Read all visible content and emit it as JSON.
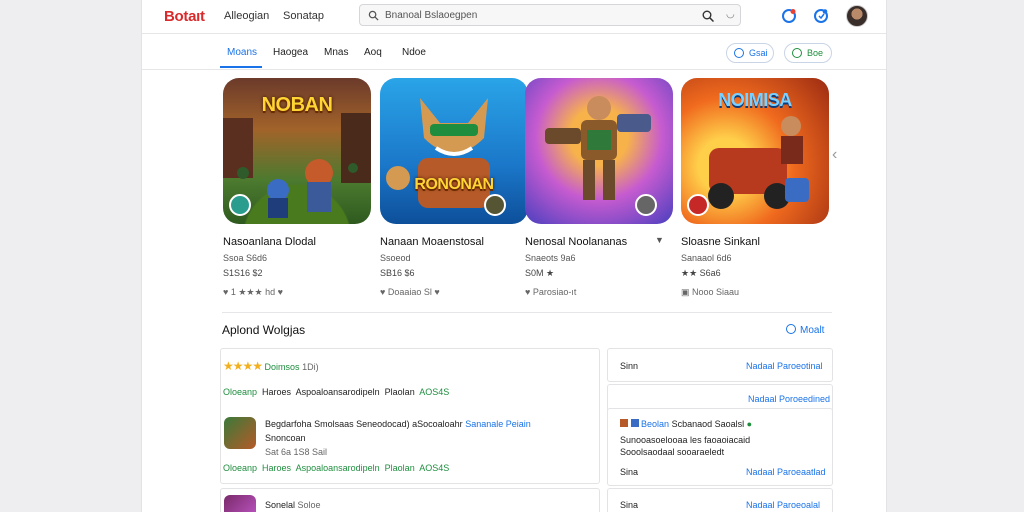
{
  "header": {
    "logo": "Botaıt",
    "nav": [
      "Alleogian",
      "Sonatap"
    ],
    "search_text": "Bnanoal Bslaoegpen",
    "mic": "◡",
    "icons": [
      "search-icon",
      "notification-icon",
      "apps-icon"
    ]
  },
  "tabs": {
    "items": [
      "Moans",
      "Haogea",
      "Mnas",
      "Aoq",
      "Ndoe"
    ],
    "active": 0,
    "pill_1": "Gsai",
    "pill_2": "Boe"
  },
  "cards": [
    {
      "art_title": "NOBAN",
      "title": "Nasoanlana Dlodal",
      "sub": "Ssoa S6d6",
      "meta": "S1S16 $2",
      "foot": "1 ★★★  hd"
    },
    {
      "art_title": "RONONAN",
      "title": "Nanaan Moaenstosal",
      "sub": "Ssoeod",
      "meta": "SB16 $6",
      "foot": "Doaaiao Sl"
    },
    {
      "art_title": "",
      "title": "Nenosal Noolananas",
      "sub": "Snaeots 9a6",
      "meta": "S0M ★",
      "foot": "Parosiao-ıt"
    },
    {
      "art_title": "NOIMISA",
      "title": "Sloasne Sinkanl",
      "sub": "Sanaaol 6d6",
      "meta": "★★ S6a6",
      "foot": "Nooo Siaau"
    }
  ],
  "section": {
    "title": "Aplond Wolgjas",
    "link": "Moalt"
  },
  "left_panel": {
    "rating_text": "Doimsos",
    "rating_count": "1Di)",
    "row1": {
      "a": "Oloeanp",
      "b": "Haroes",
      "c": "Aspoaloansarodipeln",
      "d": "Plaolan",
      "e": "AOS4S"
    },
    "item1": {
      "title": "Begdarfoha",
      "desc": "Smolsaas Seneodocad) aSocoaloahr",
      "tag": "Sananale Peiain",
      "sub": "Snoncoan",
      "meta": "Sat 6a  1S8 Sail"
    },
    "row2": {
      "a": "Oloeanp",
      "b": "Haroes",
      "c": "Aspoaloansarodipeln",
      "d": "Plaolan",
      "e": "AOS4S"
    },
    "item2": {
      "title": "Sonelal",
      "tag": "Soloe"
    }
  },
  "right_panel": {
    "r1_label": "Sinn",
    "r1_link": "Nadaal Paroeotinal",
    "r2_link": "Nadaal Poroeedined",
    "r3_user": "Beolan",
    "r3_text": "Scbanaod Saoalsl",
    "r3_body": "Sunooasoelooaa les faoaoiacaid",
    "r3_body2": "Sooolsaodaal sooaraeledt",
    "r3_label": "Sina",
    "r3_link": "Nadaal Paroeaatlad",
    "r4_label": "Sina",
    "r4_link": "Nadaal Paroeoalal"
  }
}
